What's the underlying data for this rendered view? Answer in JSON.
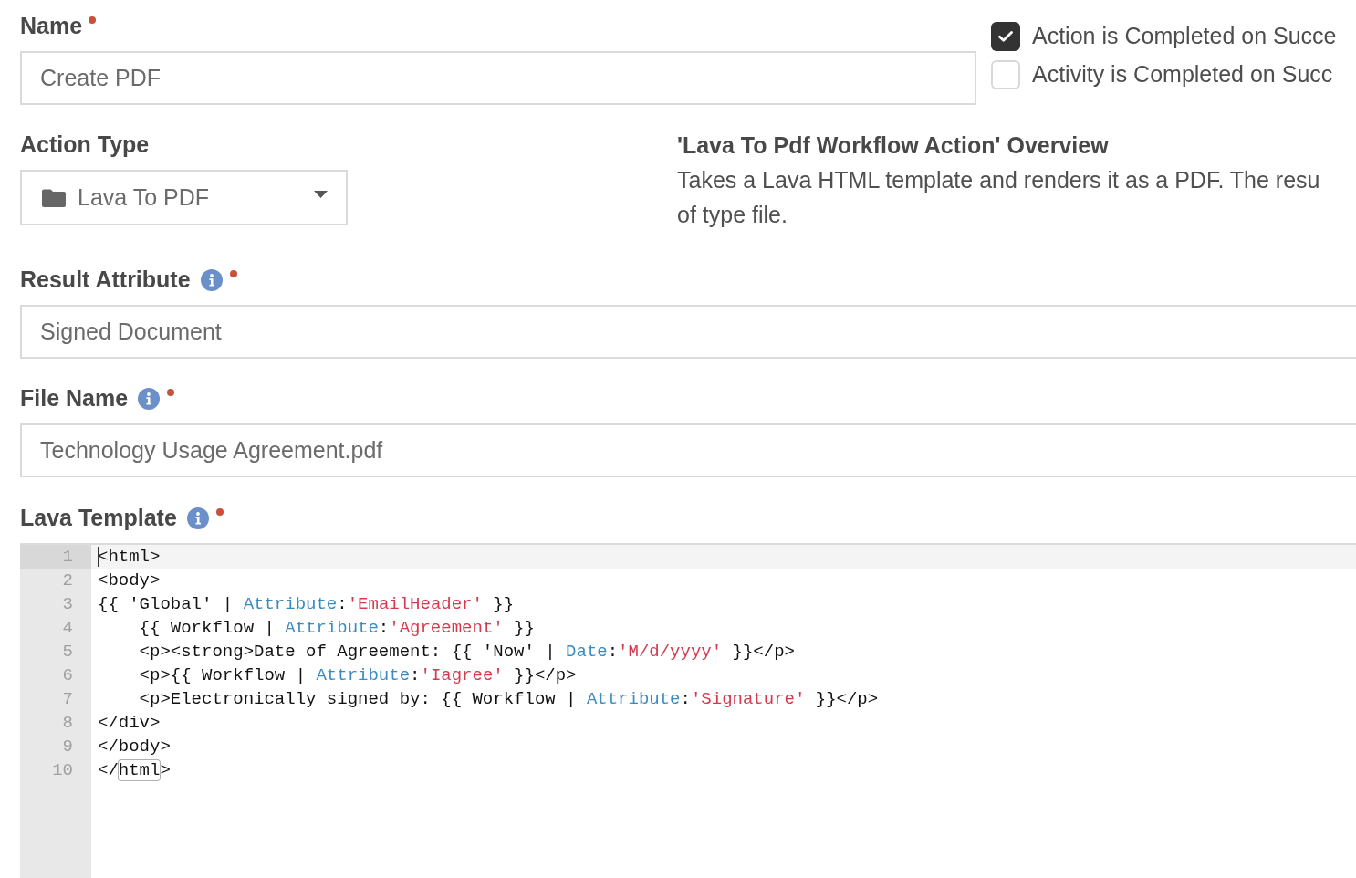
{
  "name": {
    "label": "Name",
    "info": false,
    "required": true,
    "value": "Create PDF"
  },
  "completion_options": [
    {
      "label": "Action is Completed on Succe",
      "checked": true
    },
    {
      "label": "Activity is Completed on Succ",
      "checked": false
    }
  ],
  "action_type": {
    "label": "Action Type",
    "info": false,
    "required": false,
    "value": "Lava To PDF"
  },
  "overview": {
    "title": "'Lava To Pdf Workflow Action' Overview",
    "text": "Takes a Lava HTML template and renders it as a PDF. The resu\nof type file."
  },
  "fields": [
    {
      "label": "Result Attribute",
      "info": true,
      "required": true,
      "value": "Signed Document"
    },
    {
      "label": "File Name",
      "info": true,
      "required": true,
      "value": "Technology Usage Agreement.pdf"
    }
  ],
  "lava_template": {
    "label": "Lava Template",
    "info": true,
    "required": true,
    "lines": [
      {
        "number": "1",
        "active": true,
        "tokens": [
          {
            "text": "<html>",
            "kind": "plain"
          }
        ]
      },
      {
        "number": "2",
        "active": false,
        "tokens": [
          {
            "text": "<body>",
            "kind": "plain"
          }
        ]
      },
      {
        "number": "3",
        "active": false,
        "tokens": [
          {
            "text": "{{ 'Global' | ",
            "kind": "plain"
          },
          {
            "text": "Attribute",
            "kind": "filter"
          },
          {
            "text": ":",
            "kind": "plain"
          },
          {
            "text": "'EmailHeader'",
            "kind": "string"
          },
          {
            "text": " }}",
            "kind": "plain"
          }
        ]
      },
      {
        "number": "4",
        "active": false,
        "tokens": [
          {
            "text": "    {{ Workflow | ",
            "kind": "plain"
          },
          {
            "text": "Attribute",
            "kind": "filter"
          },
          {
            "text": ":",
            "kind": "plain"
          },
          {
            "text": "'Agreement'",
            "kind": "string"
          },
          {
            "text": " }}",
            "kind": "plain"
          }
        ]
      },
      {
        "number": "5",
        "active": false,
        "tokens": [
          {
            "text": "    <p><strong>Date of Agreement: {{ 'Now' | ",
            "kind": "plain"
          },
          {
            "text": "Date",
            "kind": "filter"
          },
          {
            "text": ":",
            "kind": "plain"
          },
          {
            "text": "'M/d/yyyy'",
            "kind": "string"
          },
          {
            "text": " }}</p>",
            "kind": "plain"
          }
        ]
      },
      {
        "number": "6",
        "active": false,
        "tokens": [
          {
            "text": "    <p>{{ Workflow | ",
            "kind": "plain"
          },
          {
            "text": "Attribute",
            "kind": "filter"
          },
          {
            "text": ":",
            "kind": "plain"
          },
          {
            "text": "'Iagree'",
            "kind": "string"
          },
          {
            "text": " }}</p>",
            "kind": "plain"
          }
        ]
      },
      {
        "number": "7",
        "active": false,
        "tokens": [
          {
            "text": "    <p>Electronically signed by: {{ Workflow | ",
            "kind": "plain"
          },
          {
            "text": "Attribute",
            "kind": "filter"
          },
          {
            "text": ":",
            "kind": "plain"
          },
          {
            "text": "'Signature'",
            "kind": "string"
          },
          {
            "text": " }}</p>",
            "kind": "plain"
          }
        ]
      },
      {
        "number": "8",
        "active": false,
        "tokens": [
          {
            "text": "</div>",
            "kind": "plain"
          }
        ]
      },
      {
        "number": "9",
        "active": false,
        "tokens": [
          {
            "text": "</body>",
            "kind": "plain"
          }
        ]
      },
      {
        "number": "10",
        "active": false,
        "tokens": [
          {
            "text": "</",
            "kind": "plain"
          },
          {
            "text": "html",
            "kind": "match"
          },
          {
            "text": ">",
            "kind": "plain"
          }
        ]
      }
    ]
  }
}
